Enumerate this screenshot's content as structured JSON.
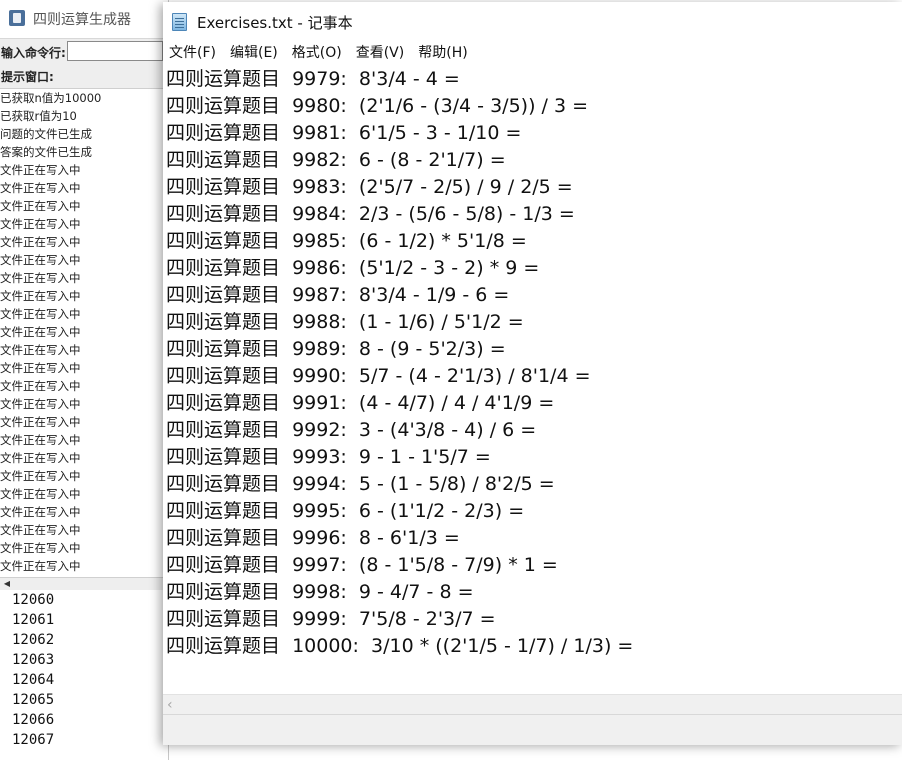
{
  "java_app": {
    "title": "四则运算生成器",
    "command_label": "输入命令行:",
    "command_value": "",
    "hint_label": "提示窗口:",
    "log_lines": [
      "已获取n值为10000",
      "已获取r值为10",
      "问题的文件已生成",
      "答案的文件已生成",
      "文件正在写入中",
      "文件正在写入中",
      "文件正在写入中",
      "文件正在写入中",
      "文件正在写入中",
      "文件正在写入中",
      "文件正在写入中",
      "文件正在写入中",
      "文件正在写入中",
      "文件正在写入中",
      "文件正在写入中",
      "文件正在写入中",
      "文件正在写入中",
      "文件正在写入中",
      "文件正在写入中",
      "文件正在写入中",
      "文件正在写入中",
      "文件正在写入中",
      "文件正在写入中",
      "文件正在写入中",
      "文件正在写入中",
      "文件正在写入中",
      "文件正在写入中"
    ],
    "numbers": [
      "12060",
      "12061",
      "12062",
      "12063",
      "12064",
      "12065",
      "12066",
      "12067"
    ]
  },
  "notepad": {
    "title": "Exercises.txt - 记事本",
    "menu": [
      "文件(F)",
      "编辑(E)",
      "格式(O)",
      "查看(V)",
      "帮助(H)"
    ],
    "lines": [
      "四则运算题目  9979:  8'3/4 - 4 =",
      "四则运算题目  9980:  (2'1/6 - (3/4 - 3/5)) / 3 =",
      "四则运算题目  9981:  6'1/5 - 3 - 1/10 =",
      "四则运算题目  9982:  6 - (8 - 2'1/7) =",
      "四则运算题目  9983:  (2'5/7 - 2/5) / 9 / 2/5 =",
      "四则运算题目  9984:  2/3 - (5/6 - 5/8) - 1/3 =",
      "四则运算题目  9985:  (6 - 1/2) * 5'1/8 =",
      "四则运算题目  9986:  (5'1/2 - 3 - 2) * 9 =",
      "四则运算题目  9987:  8'3/4 - 1/9 - 6 =",
      "四则运算题目  9988:  (1 - 1/6) / 5'1/2 =",
      "四则运算题目  9989:  8 - (9 - 5'2/3) =",
      "四则运算题目  9990:  5/7 - (4 - 2'1/3) / 8'1/4 =",
      "四则运算题目  9991:  (4 - 4/7) / 4 / 4'1/9 =",
      "四则运算题目  9992:  3 - (4'3/8 - 4) / 6 =",
      "四则运算题目  9993:  9 - 1 - 1'5/7 =",
      "四则运算题目  9994:  5 - (1 - 5/8) / 8'2/5 =",
      "四则运算题目  9995:  6 - (1'1/2 - 2/3) =",
      "四则运算题目  9996:  8 - 6'1/3 =",
      "四则运算题目  9997:  (8 - 1'5/8 - 7/9) * 1 =",
      "四则运算题目  9998:  9 - 4/7 - 8 =",
      "四则运算题目  9999:  7'5/8 - 2'3/7 =",
      "四则运算题目  10000:  3/10 * ((2'1/5 - 1/7) / 1/3) ="
    ]
  }
}
